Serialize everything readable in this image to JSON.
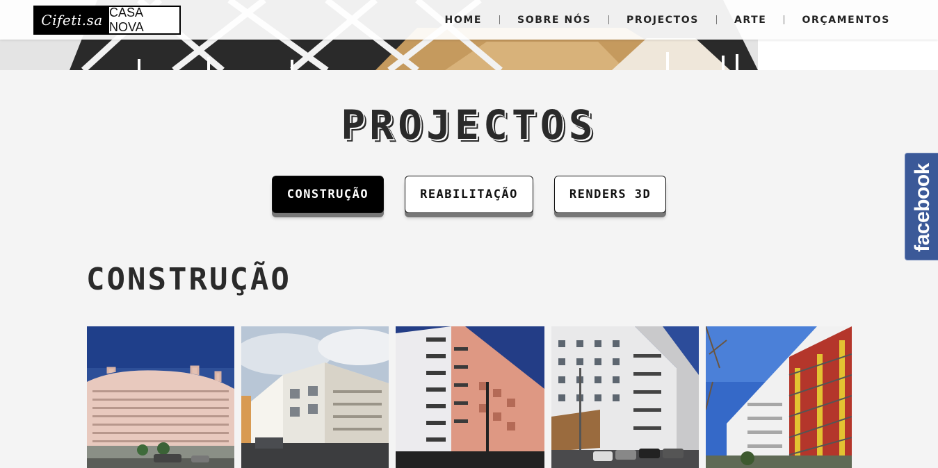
{
  "header": {
    "logo_script": "Cifeti.sa",
    "logo_text": "CASA NOVA",
    "nav": [
      {
        "label": "HOME"
      },
      {
        "label": "SOBRE NÓS"
      },
      {
        "label": "PROJECTOS"
      },
      {
        "label": "ARTE"
      },
      {
        "label": "ORÇAMENTOS"
      }
    ]
  },
  "page": {
    "title": "PROJECTOS"
  },
  "filters": [
    {
      "label": "CONSTRUÇÃO",
      "active": true
    },
    {
      "label": "REABILITAÇÃO",
      "active": false
    },
    {
      "label": "RENDERS 3D",
      "active": false
    }
  ],
  "section": {
    "title": "CONSTRUÇÃO"
  },
  "gallery": [
    {
      "subject": "pink-curved-apartment-block"
    },
    {
      "subject": "white-apartment-corner"
    },
    {
      "subject": "pink-and-white-balconies"
    },
    {
      "subject": "white-tall-apartment-street"
    },
    {
      "subject": "modern-block-red-balconies"
    }
  ],
  "social": {
    "facebook_label": "facebook",
    "facebook_color": "#3b5998"
  },
  "colors": {
    "background": "#f4f4f4",
    "text_dark": "#2a2a2a",
    "active_button": "#000000"
  }
}
